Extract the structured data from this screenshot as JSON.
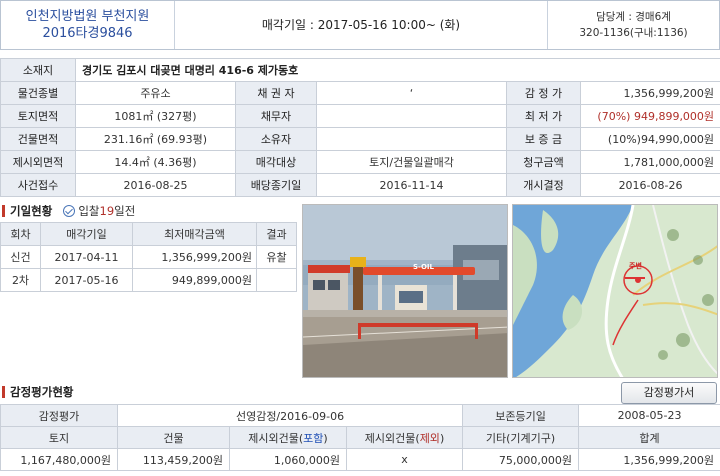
{
  "header": {
    "court": "인천지방법원 부천지원",
    "case_no": "2016타경9846",
    "sale_date": "매각기일 : 2017-05-16   10:00~ (화)",
    "dept": "담당계 : 경매6계",
    "phone": "320-1136(구내:1136)"
  },
  "info": {
    "address_label": "소재지",
    "address": "경기도 김포시 대곶면 대명리 416-6 제가동호",
    "rows": [
      {
        "l1": "물건종별",
        "v1": "주유소",
        "l2": "채 권 자",
        "v2": "‘",
        "l3": "감 정 가",
        "v3": "1,356,999,200원"
      },
      {
        "l1": "토지면적",
        "v1": "1081㎡ (327평)",
        "l2": "채무자",
        "v2": "",
        "l3": "최 저 가",
        "v3": "(70%) 949,899,000원"
      },
      {
        "l1": "건물면적",
        "v1": "231.16㎡ (69.93평)",
        "l2": "소유자",
        "v2": "",
        "l3": "보 증 금",
        "v3": "(10%)94,990,000원"
      },
      {
        "l1": "제시외면적",
        "v1": "14.4㎡ (4.36평)",
        "l2": "매각대상",
        "v2": "토지/건물일괄매각",
        "l3": "청구금액",
        "v3": "1,781,000,000원"
      },
      {
        "l1": "사건접수",
        "v1": "2016-08-25",
        "l2": "배당종기일",
        "v2": "2016-11-14",
        "l3": "개시결정",
        "v3": "2016-08-26"
      }
    ]
  },
  "history": {
    "title": "기일현황",
    "bid_prefix": "입찰",
    "bid_days": "19",
    "bid_suffix": "일전",
    "headers": [
      "회차",
      "매각기일",
      "최저매각금액",
      "결과"
    ],
    "rows": [
      {
        "round": "신건",
        "date": "2017-04-11",
        "price": "1,356,999,200원",
        "result": "유찰"
      },
      {
        "round": "2차",
        "date": "2017-05-16",
        "price": "949,899,000원",
        "result": ""
      }
    ]
  },
  "photo": {
    "sign": "S-OIL",
    "sign_color": "#e8b21a",
    "canopy_color": "#e24a2c"
  },
  "map": {
    "marker": "주변",
    "water_color": "#3f87c9",
    "land_color": "#cfe3c1"
  },
  "appraisal": {
    "title": "감정평가현황",
    "button": "감정평가서",
    "row1": {
      "l1": "감정평가",
      "v1": "선영감정/2016-09-06",
      "l2": "보존등기일",
      "v2": "2008-05-23"
    },
    "headers": {
      "land": "토지",
      "building": "건물",
      "extra_incl_pre": "제시외건물(",
      "extra_incl_word": "포함",
      "extra_excl_pre": "제시외건물(",
      "extra_excl_word": "제외",
      "close": ")",
      "other": "기타(기계기구)",
      "total": "합계"
    },
    "values": {
      "land": "1,167,480,000원",
      "building": "113,459,200원",
      "extra_incl": "1,060,000원",
      "extra_excl": "x",
      "other": "75,000,000원",
      "total": "1,356,999,200원"
    }
  }
}
